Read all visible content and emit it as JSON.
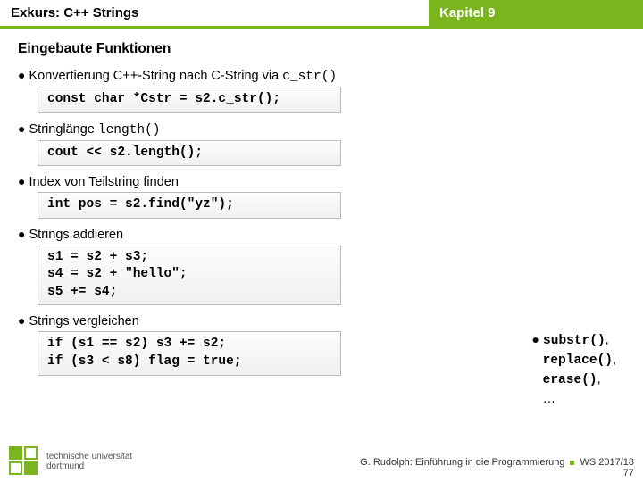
{
  "header": {
    "left": "Exkurs: C++ Strings",
    "right": "Kapitel 9"
  },
  "subtitle": "Eingebaute Funktionen",
  "items": [
    {
      "label_pre": "Konvertierung C++-String nach C-String via ",
      "label_code": "c_str()",
      "code": "const char *Cstr = s2.c_str();"
    },
    {
      "label_pre": "Stringlänge ",
      "label_code": "length()",
      "code": "cout << s2.length();"
    },
    {
      "label_pre": "Index von Teilstring finden",
      "label_code": "",
      "code": "int pos = s2.find(\"yz\");"
    },
    {
      "label_pre": "Strings addieren",
      "label_code": "",
      "code": "s1 = s2 + s3;\ns4 = s2 + \"hello\";\ns5 += s4;"
    },
    {
      "label_pre": "Strings vergleichen",
      "label_code": "",
      "code": "if (s1 == s2) s3 += s2;\nif (s3 < s8) flag = true;"
    }
  ],
  "rightcol": {
    "fn1": "substr()",
    "fn2": "replace()",
    "fn3": "erase()",
    "more": "…"
  },
  "footer": {
    "author": "G. Rudolph: Einführung in die Programmierung",
    "term": "WS 2017/18",
    "page": "77"
  },
  "logo": {
    "line1": "technische universität",
    "line2": "dortmund"
  }
}
